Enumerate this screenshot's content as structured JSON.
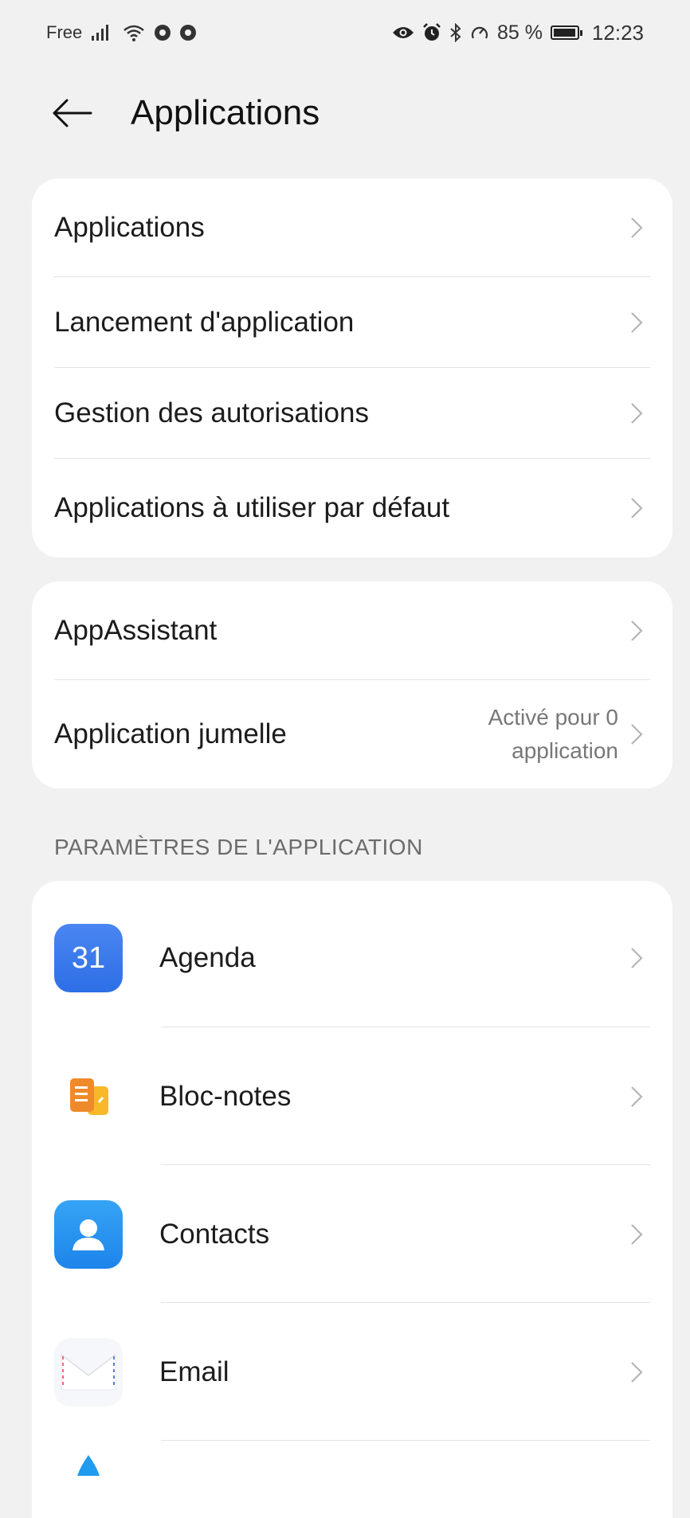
{
  "status_bar": {
    "carrier": "Free",
    "battery_percent": "85 %",
    "time": "12:23",
    "icons": [
      "signal-icon",
      "wifi-icon",
      "chrome-icon",
      "chrome-icon",
      "eye-icon",
      "alarm-icon",
      "bluetooth-icon",
      "speed-icon",
      "battery-icon"
    ]
  },
  "header": {
    "title": "Applications",
    "back_icon": "arrow-left-icon"
  },
  "group1": {
    "items": [
      {
        "label": "Applications"
      },
      {
        "label": "Lancement d'application"
      },
      {
        "label": "Gestion des autorisations"
      },
      {
        "label": "Applications à utiliser par défaut"
      }
    ]
  },
  "group2": {
    "items": [
      {
        "label": "AppAssistant"
      },
      {
        "label": "Application jumelle",
        "value_line1": "Activé pour 0",
        "value_line2": "application"
      }
    ]
  },
  "app_settings": {
    "section_title": "PARAMÈTRES DE L'APPLICATION",
    "items": [
      {
        "label": "Agenda",
        "icon": "calendar-icon",
        "icon_text": "31",
        "accent": "#3a7ced"
      },
      {
        "label": "Bloc-notes",
        "icon": "notepad-icon",
        "accent": "#f39a2b"
      },
      {
        "label": "Contacts",
        "icon": "contacts-icon",
        "accent": "#2492ef"
      },
      {
        "label": "Email",
        "icon": "email-icon",
        "accent": "#e86a78"
      }
    ]
  }
}
